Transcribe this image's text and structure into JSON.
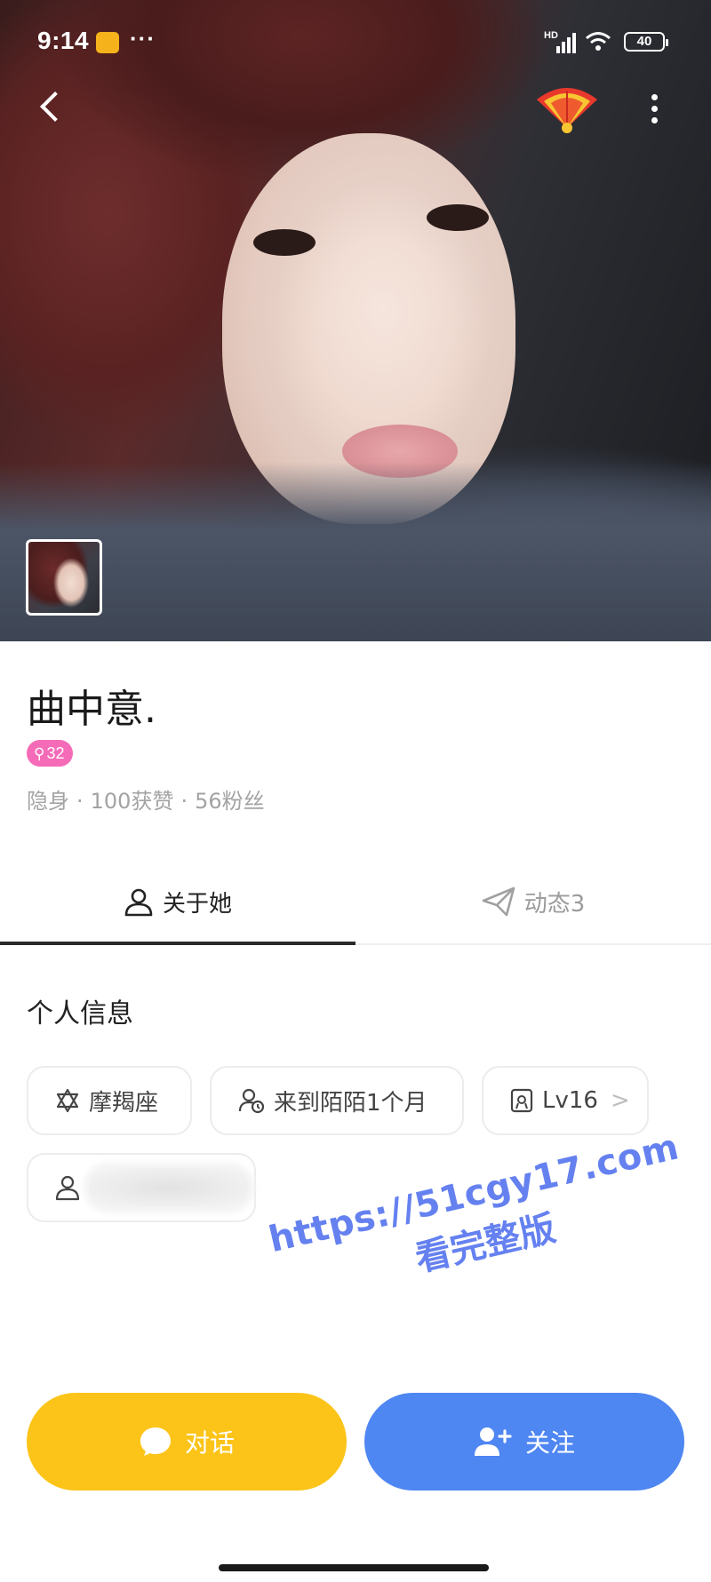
{
  "status_bar": {
    "time": "9:14",
    "more": "···",
    "network": "HD",
    "battery": "40",
    "note_icon": "note-app-icon",
    "wifi_icon": "wifi-icon",
    "signal_icon": "signal-icon"
  },
  "top_bar": {
    "back_icon": "chevron-left-icon",
    "gift_icon": "red-fan-gift-icon",
    "more_icon": "vertical-dots-icon"
  },
  "profile": {
    "name": "曲中意.",
    "age": "32",
    "gender_icon": "female-icon",
    "status": "隐身",
    "likes": "100获赞",
    "fans": "56粉丝",
    "separator": "·"
  },
  "tabs": [
    {
      "label": "关于她",
      "icon": "person-icon",
      "active": true
    },
    {
      "label": "动态3",
      "icon": "paper-plane-icon",
      "active": false
    }
  ],
  "info": {
    "section_title": "个人信息",
    "chips": [
      {
        "label": "摩羯座",
        "icon": "star-of-david-icon"
      },
      {
        "label": "来到陌陌1个月",
        "icon": "person-clock-icon"
      },
      {
        "label": "Lv16",
        "icon": "level-badge-icon",
        "chevron": ">"
      },
      {
        "label": "",
        "icon": "person-icon",
        "blurred": true
      }
    ]
  },
  "watermark": {
    "url": "https://51cgy17.com",
    "cta": "看完整版"
  },
  "actions": {
    "chat_label": "对话",
    "follow_label": "关注"
  },
  "colors": {
    "chat_button": "#fcc419",
    "follow_button": "#4e86f2",
    "age_badge": "#f56bb7",
    "watermark": "#5d7bf0"
  }
}
